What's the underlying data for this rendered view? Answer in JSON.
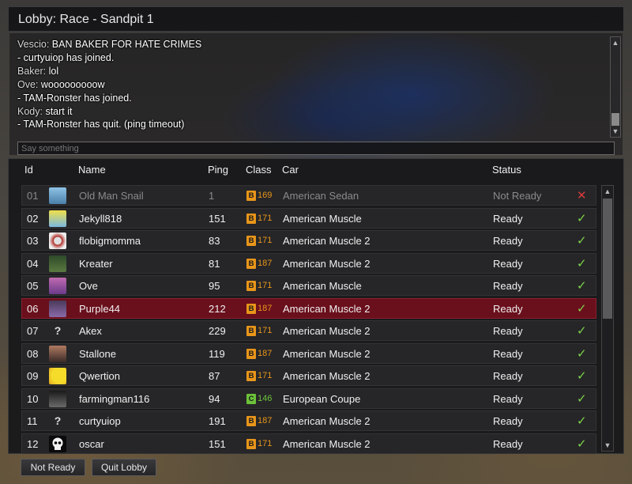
{
  "window": {
    "title": "Lobby: Race - Sandpit 1"
  },
  "chat": {
    "lines": [
      {
        "name": "Vescio:",
        "text": "BAN BAKER FOR HATE CRIMES"
      },
      {
        "name": "",
        "text": "- curtyuiop has joined."
      },
      {
        "name": "Baker:",
        "text": "lol"
      },
      {
        "name": "Ove:",
        "text": "wooooooooow"
      },
      {
        "name": "",
        "text": "- TAM-Ronster has joined."
      },
      {
        "name": "Kody:",
        "text": "start it"
      },
      {
        "name": "",
        "text": "- TAM-Ronster has quit. (ping timeout)"
      }
    ],
    "input_placeholder": "Say something"
  },
  "table": {
    "headers": {
      "id": "Id",
      "name": "Name",
      "ping": "Ping",
      "class": "Class",
      "car": "Car",
      "status": "Status"
    },
    "rows": [
      {
        "id": "01",
        "name": "Old Man Snail",
        "ping": "1",
        "class_letter": "B",
        "class_num": "169",
        "car": "American Sedan",
        "status": "Not Ready",
        "ready": false,
        "avatar": "portrait-avatar",
        "dim": true,
        "selected": false
      },
      {
        "id": "02",
        "name": "Jekyll818",
        "ping": "151",
        "class_letter": "B",
        "class_num": "171",
        "car": "American Muscle",
        "status": "Ready",
        "ready": true,
        "avatar": "cartoon-avatar",
        "dim": false,
        "selected": false
      },
      {
        "id": "03",
        "name": "flobigmomma",
        "ping": "83",
        "class_letter": "B",
        "class_num": "171",
        "car": "American Muscle 2",
        "status": "Ready",
        "ready": true,
        "avatar": "logo-avatar",
        "dim": false,
        "selected": false
      },
      {
        "id": "04",
        "name": "Kreater",
        "ping": "81",
        "class_letter": "B",
        "class_num": "187",
        "car": "American Muscle 2",
        "status": "Ready",
        "ready": true,
        "avatar": "green-avatar",
        "dim": false,
        "selected": false
      },
      {
        "id": "05",
        "name": "Ove",
        "ping": "95",
        "class_letter": "B",
        "class_num": "171",
        "car": "American Muscle",
        "status": "Ready",
        "ready": true,
        "avatar": "anime-avatar",
        "dim": false,
        "selected": false
      },
      {
        "id": "06",
        "name": "Purple44",
        "ping": "212",
        "class_letter": "B",
        "class_num": "187",
        "car": "American Muscle 2",
        "status": "Ready",
        "ready": true,
        "avatar": "car-avatar",
        "dim": false,
        "selected": true
      },
      {
        "id": "07",
        "name": "Akex",
        "ping": "229",
        "class_letter": "B",
        "class_num": "171",
        "car": "American Muscle 2",
        "status": "Ready",
        "ready": true,
        "avatar": "unknown-avatar",
        "dim": false,
        "selected": false
      },
      {
        "id": "08",
        "name": "Stallone",
        "ping": "119",
        "class_letter": "B",
        "class_num": "187",
        "car": "American Muscle 2",
        "status": "Ready",
        "ready": true,
        "avatar": "face-avatar",
        "dim": false,
        "selected": false
      },
      {
        "id": "09",
        "name": "Qwertion",
        "ping": "87",
        "class_letter": "B",
        "class_num": "171",
        "car": "American Muscle 2",
        "status": "Ready",
        "ready": true,
        "avatar": "pikachu-avatar",
        "dim": false,
        "selected": false
      },
      {
        "id": "10",
        "name": "farmingman116",
        "ping": "94",
        "class_letter": "C",
        "class_num": "146",
        "car": "European Coupe",
        "status": "Ready",
        "ready": true,
        "avatar": "truck-avatar",
        "dim": false,
        "selected": false
      },
      {
        "id": "11",
        "name": "curtyuiop",
        "ping": "191",
        "class_letter": "B",
        "class_num": "187",
        "car": "American Muscle 2",
        "status": "Ready",
        "ready": true,
        "avatar": "unknown-avatar",
        "dim": false,
        "selected": false
      },
      {
        "id": "12",
        "name": "oscar",
        "ping": "151",
        "class_letter": "B",
        "class_num": "171",
        "car": "American Muscle 2",
        "status": "Ready",
        "ready": true,
        "avatar": "skull-avatar",
        "dim": false,
        "selected": false
      }
    ]
  },
  "buttons": {
    "not_ready": "Not Ready",
    "quit_lobby": "Quit Lobby"
  },
  "colors": {
    "class_b": "#e8951a",
    "class_c": "#6cc23a",
    "ready_check": "#7cd44a",
    "not_ready_x": "#d83a3a",
    "selected_row": "#6a0f1c"
  }
}
